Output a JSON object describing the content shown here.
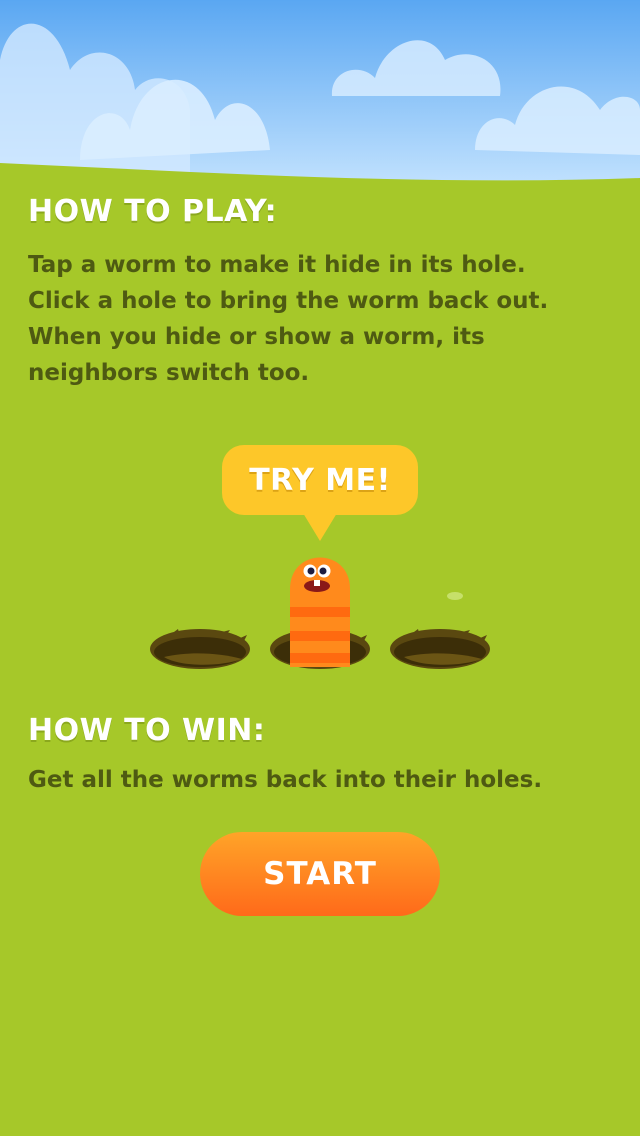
{
  "instructions": {
    "how_to_play_title": "HOW TO PLAY:",
    "how_to_play_lines": [
      "Tap a worm to make it hide in its hole.",
      "Click a hole to bring the worm back out.",
      "When you hide or show a worm, its",
      "neighbors switch too."
    ],
    "how_to_win_title": "HOW TO WIN:",
    "how_to_win_text": "Get all the worms back into their holes."
  },
  "demo": {
    "bubble_text": "TRY ME!",
    "holes": [
      {
        "has_worm": false
      },
      {
        "has_worm": true
      },
      {
        "has_worm": false
      }
    ]
  },
  "start_button": {
    "label": "START"
  },
  "colors": {
    "grass": "#a6c829",
    "sky_top": "#5aa7f2",
    "sky_bottom": "#c9e6ff",
    "heading_text": "#ffffff",
    "body_text": "#4e5a12",
    "bubble": "#fdc729",
    "worm_orange": "#ff8a1c",
    "worm_stripe": "#ff6a10",
    "hole_dark": "#4a3a0c",
    "start_top": "#ffa428",
    "start_bottom": "#ff6a1a"
  }
}
